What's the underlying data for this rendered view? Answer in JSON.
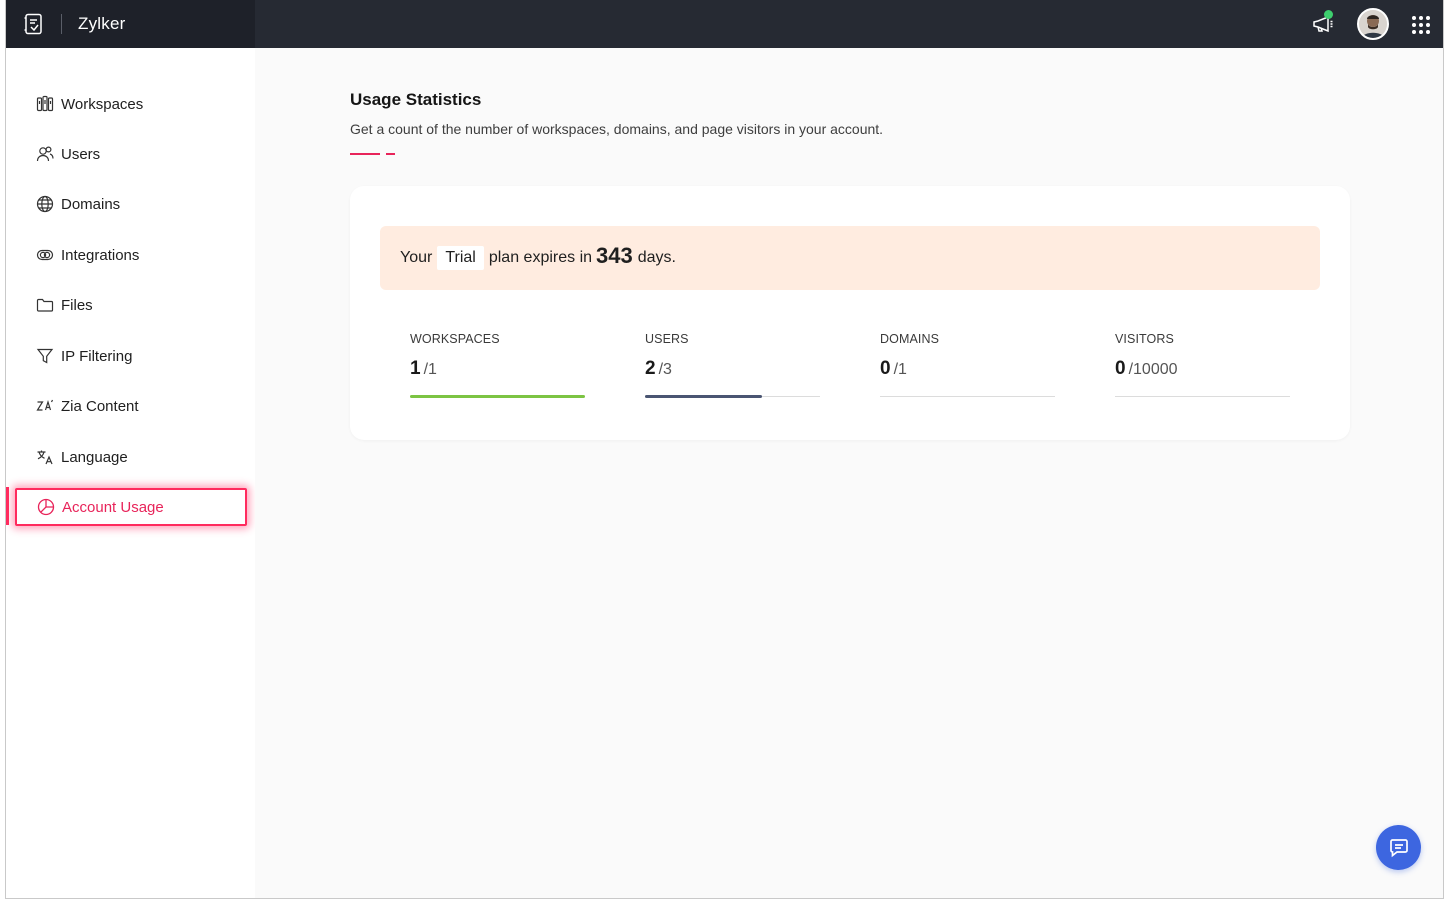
{
  "app": {
    "brand_name": "Zylker"
  },
  "sidebar": {
    "items": [
      {
        "label": "Workspaces",
        "icon": "workspaces-icon"
      },
      {
        "label": "Users",
        "icon": "users-icon"
      },
      {
        "label": "Domains",
        "icon": "globe-icon"
      },
      {
        "label": "Integrations",
        "icon": "integrations-icon"
      },
      {
        "label": "Files",
        "icon": "folder-icon"
      },
      {
        "label": "IP Filtering",
        "icon": "filter-icon"
      },
      {
        "label": "Zia Content",
        "icon": "zia-icon"
      },
      {
        "label": "Language",
        "icon": "translate-icon"
      },
      {
        "label": "Account Usage",
        "icon": "pie-chart-icon",
        "active": true
      }
    ]
  },
  "main": {
    "title": "Usage Statistics",
    "subtitle": "Get a count of the number of workspaces, domains, and page visitors in your account.",
    "accent_color": "#e8245a",
    "trial": {
      "prefix": "Your",
      "plan": "Trial",
      "middle": "plan expires in",
      "days": "343",
      "suffix": "days."
    },
    "stats": [
      {
        "label": "WORKSPACES",
        "used": "1",
        "max": "/1",
        "fraction": 1.0,
        "bar_color": "#7cc443"
      },
      {
        "label": "USERS",
        "used": "2",
        "max": "/3",
        "fraction": 0.6667,
        "bar_color": "#4a5572"
      },
      {
        "label": "DOMAINS",
        "used": "0",
        "max": "/1",
        "fraction": 0.0,
        "bar_color": "#7cc443"
      },
      {
        "label": "VISITORS",
        "used": "0",
        "max": "/10000",
        "fraction": 0.0,
        "bar_color": "#7cc443"
      }
    ]
  },
  "colors": {
    "topbar": "#262a33",
    "chat_button": "#3d66e0",
    "notification_dot": "#3ecf6e"
  }
}
